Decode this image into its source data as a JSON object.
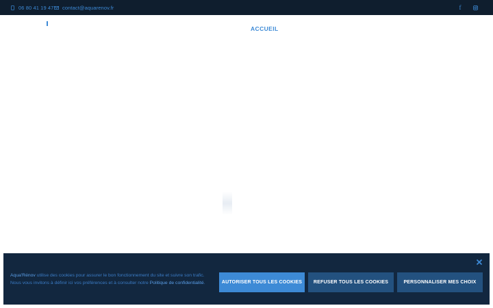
{
  "topbar": {
    "phone": "06 80 41 19 47",
    "email": "contact@aquarenov.fr",
    "social": [
      "facebook-icon",
      "instagram-icon"
    ],
    "facebook_glyph": "f"
  },
  "nav": {
    "home_label": "ACCUEIL"
  },
  "cookie": {
    "brand": "Aqua'Rénov",
    "text_line1": " utilise des cookies pour assurer le bon fonctionnement du site et suivre son trafic.",
    "text_line2": "Nous vous invitons à définir ici vos préférences et à consulter notre ",
    "policy_link": "Politique de confidentialité",
    "text_end": ".",
    "accept_label": "AUTORISER TOUS LES COOKIES",
    "refuse_label": "REFUSER TOUS LES COOKIES",
    "customize_label": "PERSONNALISER MES CHOIX"
  },
  "colors": {
    "topbar_bg": "#0f1e2e",
    "accent": "#3d8ad6",
    "banner_bg": "#12273f",
    "button_dark": "#23517f"
  }
}
